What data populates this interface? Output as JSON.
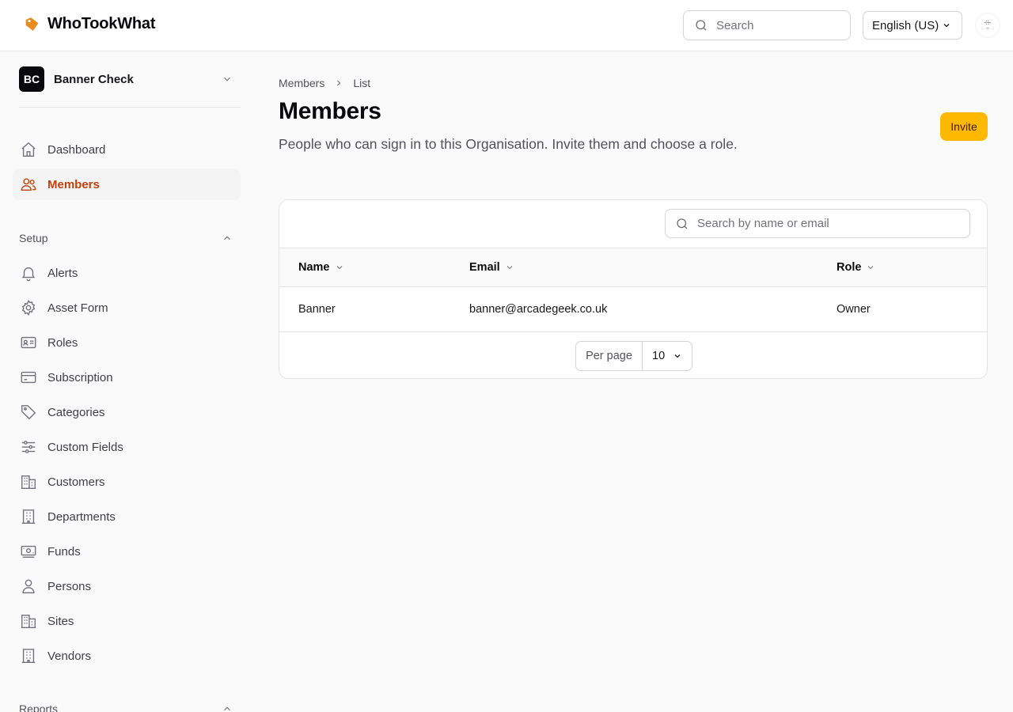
{
  "app": {
    "name": "WhoTookWhat"
  },
  "header": {
    "search_placeholder": "Search",
    "language": "English (US)"
  },
  "sidebar": {
    "org": {
      "initials": "BC",
      "name": "Banner Check"
    },
    "primary": [
      {
        "label": "Dashboard",
        "icon": "home-icon"
      },
      {
        "label": "Members",
        "icon": "users-icon",
        "active": true
      }
    ],
    "setup": {
      "title": "Setup",
      "items": [
        {
          "label": "Alerts",
          "icon": "bell-icon"
        },
        {
          "label": "Asset Form",
          "icon": "gear-icon"
        },
        {
          "label": "Roles",
          "icon": "id-card-icon"
        },
        {
          "label": "Subscription",
          "icon": "credit-card-icon"
        },
        {
          "label": "Categories",
          "icon": "tag-icon"
        },
        {
          "label": "Custom Fields",
          "icon": "sliders-icon"
        },
        {
          "label": "Customers",
          "icon": "building-icon"
        },
        {
          "label": "Departments",
          "icon": "office-building-icon"
        },
        {
          "label": "Funds",
          "icon": "banknote-icon"
        },
        {
          "label": "Persons",
          "icon": "person-icon"
        },
        {
          "label": "Sites",
          "icon": "building-icon"
        },
        {
          "label": "Vendors",
          "icon": "office-building-icon"
        }
      ]
    },
    "reports": {
      "title": "Reports"
    }
  },
  "main": {
    "breadcrumb": [
      "Members",
      "List"
    ],
    "title": "Members",
    "subtitle": "People who can sign in to this Organisation. Invite them and choose a role.",
    "invite_label": "Invite",
    "table": {
      "search_placeholder": "Search by name or email",
      "columns": [
        "Name",
        "Email",
        "Role"
      ],
      "rows": [
        {
          "name": "Banner",
          "email": "banner@arcadegeek.co.uk",
          "role": "Owner"
        }
      ],
      "per_page_label": "Per page",
      "per_page_value": "10"
    }
  },
  "colors": {
    "accent": "#c2410c",
    "brand": "#f97316",
    "invite": "#fcb900"
  }
}
